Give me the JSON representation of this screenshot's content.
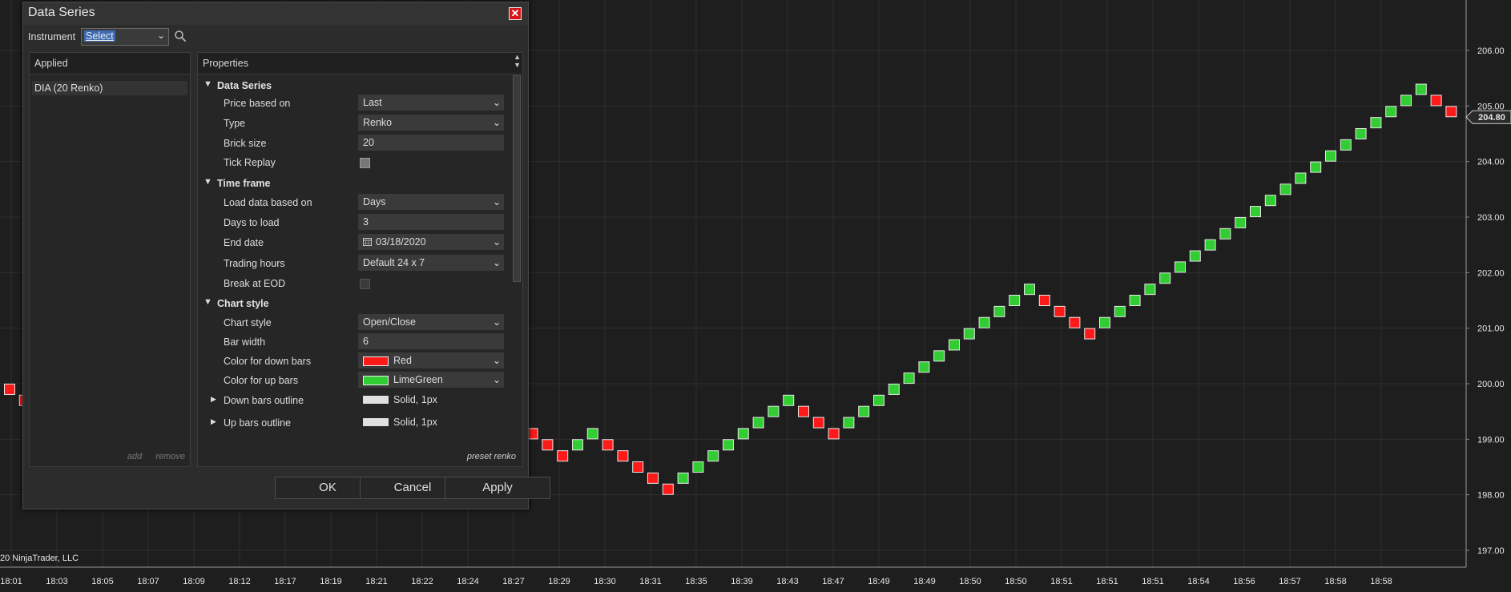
{
  "dialog": {
    "title": "Data Series",
    "close_glyph": "✕",
    "instrument_label": "Instrument",
    "instrument_value": "Select",
    "search_icon": "search-icon",
    "applied_header": "Applied",
    "applied_items": [
      "DIA (20 Renko)"
    ],
    "applied_add": "add",
    "applied_remove": "remove",
    "properties_header": "Properties",
    "preset_label": "preset renko",
    "buttons": {
      "ok": "OK",
      "cancel": "Cancel",
      "apply": "Apply"
    },
    "sections": {
      "data_series": "Data Series",
      "time_frame": "Time frame",
      "chart_style": "Chart style"
    },
    "props": {
      "price_based_on": {
        "label": "Price based on",
        "value": "Last"
      },
      "type": {
        "label": "Type",
        "value": "Renko"
      },
      "brick_size": {
        "label": "Brick size",
        "value": "20"
      },
      "tick_replay": {
        "label": "Tick Replay"
      },
      "load_data_based_on": {
        "label": "Load data based on",
        "value": "Days"
      },
      "days_to_load": {
        "label": "Days to load",
        "value": "3"
      },
      "end_date": {
        "label": "End date",
        "value": "03/18/2020"
      },
      "trading_hours": {
        "label": "Trading hours",
        "value": "Default 24 x 7"
      },
      "break_at_eod": {
        "label": "Break at EOD"
      },
      "chart_style": {
        "label": "Chart style",
        "value": "Open/Close"
      },
      "bar_width": {
        "label": "Bar width",
        "value": "6"
      },
      "color_down": {
        "label": "Color for down bars",
        "value": "Red",
        "color": "#ff1a1a"
      },
      "color_up": {
        "label": "Color for up bars",
        "value": "LimeGreen",
        "color": "#32cd32"
      },
      "down_outline": {
        "label": "Down bars outline",
        "value": "Solid, 1px"
      },
      "up_outline": {
        "label": "Up bars outline",
        "value": "Solid, 1px"
      }
    }
  },
  "chart": {
    "copyright": "20 NinjaTrader, LLC",
    "price_marker": "204.80",
    "colors": {
      "up": "#32cd32",
      "down": "#ff1a1a",
      "background": "#1e1e1e",
      "grid": "#2e2e2e"
    }
  },
  "chart_data": {
    "type": "renko",
    "brick_size": 0.2,
    "ylim": [
      196.8,
      206.3
    ],
    "y_ticks": [
      197.0,
      198.0,
      199.0,
      200.0,
      201.0,
      202.0,
      203.0,
      204.0,
      205.0,
      206.0
    ],
    "x_tick_labels": [
      "18:01",
      "18:03",
      "18:05",
      "18:07",
      "18:09",
      "18:12",
      "18:17",
      "18:19",
      "18:21",
      "18:22",
      "18:24",
      "18:27",
      "18:29",
      "18:30",
      "18:31",
      "18:35",
      "18:39",
      "18:43",
      "18:47",
      "18:49",
      "18:49",
      "18:50",
      "18:50",
      "18:51",
      "18:51",
      "18:51",
      "18:54",
      "18:56",
      "18:57",
      "18:58",
      "18:58"
    ],
    "last_price": 204.8,
    "bricks": [
      {
        "y": 199.9,
        "dir": "down"
      },
      {
        "y": 199.7,
        "dir": "down"
      },
      {
        "y": 199.1,
        "dir": "down"
      },
      {
        "y": 198.9,
        "dir": "down"
      },
      {
        "y": 198.7,
        "dir": "down"
      },
      {
        "y": 198.9,
        "dir": "up"
      },
      {
        "y": 199.1,
        "dir": "up"
      },
      {
        "y": 198.9,
        "dir": "down"
      },
      {
        "y": 198.7,
        "dir": "down"
      },
      {
        "y": 198.5,
        "dir": "down"
      },
      {
        "y": 198.3,
        "dir": "down"
      },
      {
        "y": 198.1,
        "dir": "down"
      },
      {
        "y": 198.3,
        "dir": "up"
      },
      {
        "y": 198.5,
        "dir": "up"
      },
      {
        "y": 198.7,
        "dir": "up"
      },
      {
        "y": 198.9,
        "dir": "up"
      },
      {
        "y": 199.1,
        "dir": "up"
      },
      {
        "y": 199.3,
        "dir": "up"
      },
      {
        "y": 199.5,
        "dir": "up"
      },
      {
        "y": 199.7,
        "dir": "up"
      },
      {
        "y": 199.5,
        "dir": "down"
      },
      {
        "y": 199.3,
        "dir": "down"
      },
      {
        "y": 199.1,
        "dir": "down"
      },
      {
        "y": 199.3,
        "dir": "up"
      },
      {
        "y": 199.5,
        "dir": "up"
      },
      {
        "y": 199.7,
        "dir": "up"
      },
      {
        "y": 199.9,
        "dir": "up"
      },
      {
        "y": 200.1,
        "dir": "up"
      },
      {
        "y": 200.3,
        "dir": "up"
      },
      {
        "y": 200.5,
        "dir": "up"
      },
      {
        "y": 200.7,
        "dir": "up"
      },
      {
        "y": 200.9,
        "dir": "up"
      },
      {
        "y": 201.1,
        "dir": "up"
      },
      {
        "y": 201.3,
        "dir": "up"
      },
      {
        "y": 201.5,
        "dir": "up"
      },
      {
        "y": 201.7,
        "dir": "up"
      },
      {
        "y": 201.5,
        "dir": "down"
      },
      {
        "y": 201.3,
        "dir": "down"
      },
      {
        "y": 201.1,
        "dir": "down"
      },
      {
        "y": 200.9,
        "dir": "down"
      },
      {
        "y": 201.1,
        "dir": "up"
      },
      {
        "y": 201.3,
        "dir": "up"
      },
      {
        "y": 201.5,
        "dir": "up"
      },
      {
        "y": 201.7,
        "dir": "up"
      },
      {
        "y": 201.9,
        "dir": "up"
      },
      {
        "y": 202.1,
        "dir": "up"
      },
      {
        "y": 202.3,
        "dir": "up"
      },
      {
        "y": 202.5,
        "dir": "up"
      },
      {
        "y": 202.7,
        "dir": "up"
      },
      {
        "y": 202.9,
        "dir": "up"
      },
      {
        "y": 203.1,
        "dir": "up"
      },
      {
        "y": 203.3,
        "dir": "up"
      },
      {
        "y": 203.5,
        "dir": "up"
      },
      {
        "y": 203.7,
        "dir": "up"
      },
      {
        "y": 203.9,
        "dir": "up"
      },
      {
        "y": 204.1,
        "dir": "up"
      },
      {
        "y": 204.3,
        "dir": "up"
      },
      {
        "y": 204.5,
        "dir": "up"
      },
      {
        "y": 204.7,
        "dir": "up"
      },
      {
        "y": 204.9,
        "dir": "up"
      },
      {
        "y": 205.1,
        "dir": "up"
      },
      {
        "y": 205.3,
        "dir": "up"
      },
      {
        "y": 205.1,
        "dir": "down"
      },
      {
        "y": 204.9,
        "dir": "down"
      }
    ]
  }
}
